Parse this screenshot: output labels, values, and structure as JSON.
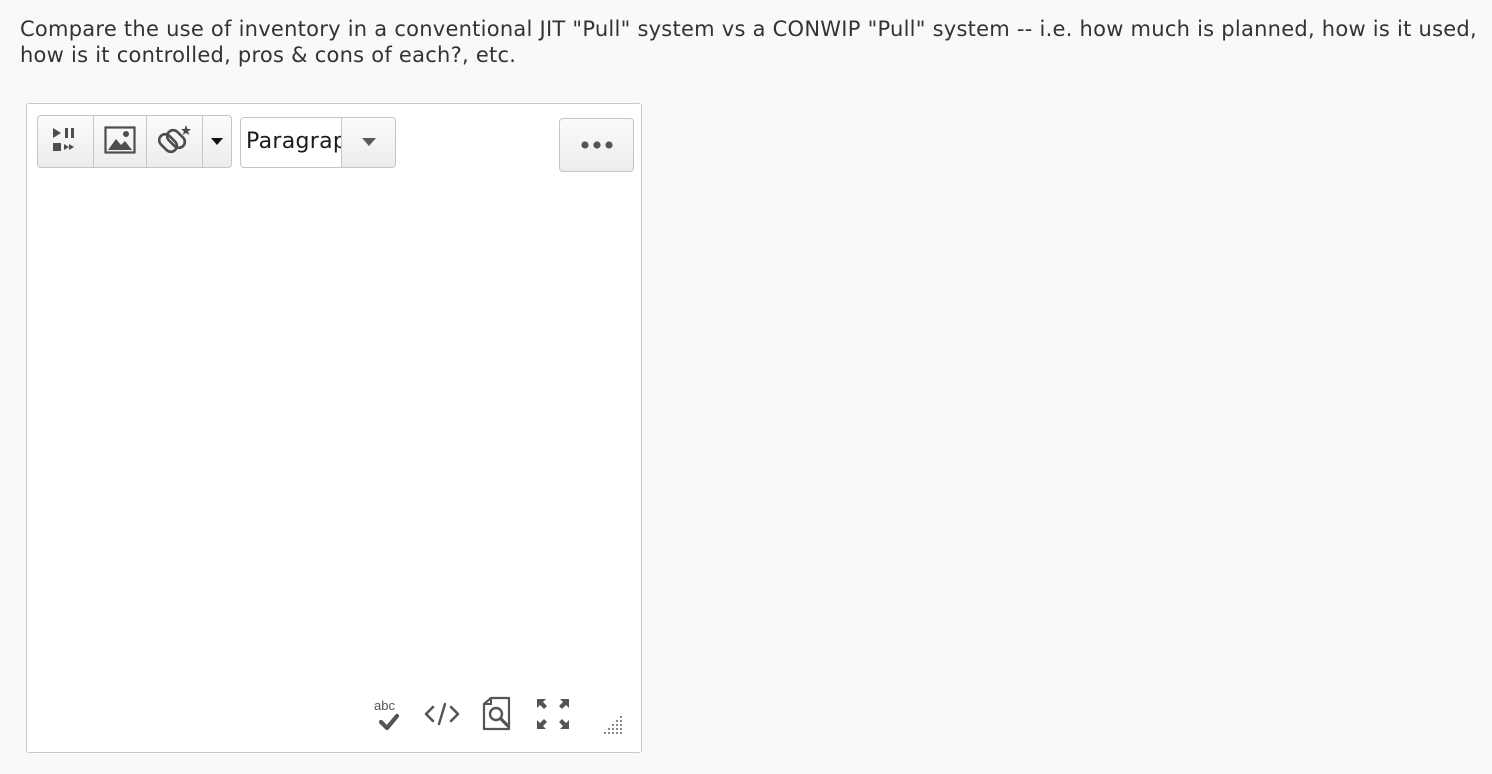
{
  "question": {
    "text": "Compare the use of inventory in a conventional JIT  \"Pull\" system vs a CONWIP \"Pull\" system -- i.e. how much is planned, how is it used, how is it controlled, pros & cons of each?, etc."
  },
  "editor": {
    "toolbar": {
      "buttons": [
        {
          "name": "media-player-icon"
        },
        {
          "name": "image-icon"
        },
        {
          "name": "link-icon"
        },
        {
          "name": "caret-down-icon"
        }
      ],
      "format_select": {
        "value": "Paragraph"
      },
      "more_button": {
        "icon": "ellipsis-icon"
      }
    },
    "content": "",
    "statusbar": {
      "spellcheck_label": "abc",
      "icons": [
        "spellcheck-icon",
        "source-code-icon",
        "preview-icon",
        "fullscreen-icon",
        "resize-handle-icon"
      ]
    }
  },
  "colors": {
    "background": "#f9f9f9",
    "editor_bg": "#ffffff",
    "border": "#c5c5c5",
    "icon": "#555555",
    "text": "#333333"
  }
}
